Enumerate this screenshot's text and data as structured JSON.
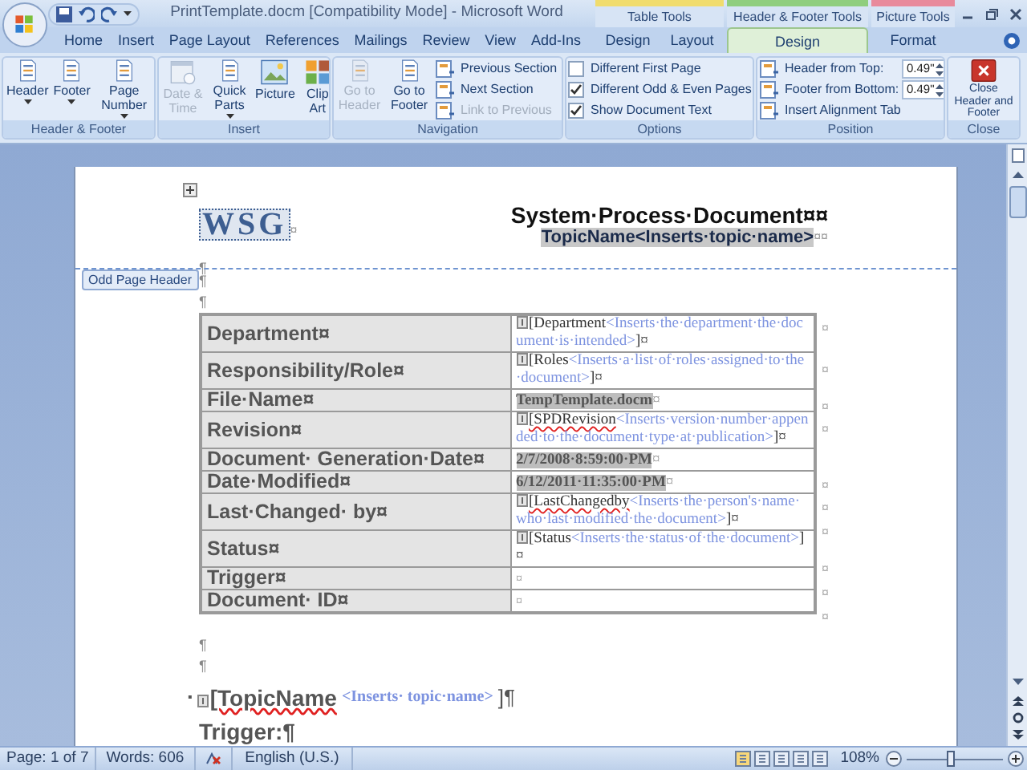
{
  "window": {
    "title": "PrintTemplate.docm [Compatibility Mode] - Microsoft Word"
  },
  "tabs": [
    {
      "label": "Home",
      "selected": false
    },
    {
      "label": "Insert",
      "selected": false
    },
    {
      "label": "Page Layout",
      "selected": false
    },
    {
      "label": "References",
      "selected": false
    },
    {
      "label": "Mailings",
      "selected": false
    },
    {
      "label": "Review",
      "selected": false
    },
    {
      "label": "View",
      "selected": false
    },
    {
      "label": "Add-Ins",
      "selected": false
    }
  ],
  "contextual": [
    {
      "title": "Table Tools",
      "color": "#f0dc6e",
      "tabs": [
        {
          "label": "Design",
          "selected": false
        },
        {
          "label": "Layout",
          "selected": false
        }
      ]
    },
    {
      "title": "Header & Footer Tools",
      "color": "#8fce7e",
      "tabs": [
        {
          "label": "Design",
          "selected": true
        }
      ]
    },
    {
      "title": "Picture Tools",
      "color": "#e88a9c",
      "tabs": [
        {
          "label": "Format",
          "selected": false
        }
      ]
    }
  ],
  "ribbon": [
    {
      "label": "Header & Footer",
      "items": [
        {
          "kind": "large",
          "label": "Header",
          "dropdown": true,
          "disabled": false
        },
        {
          "kind": "large",
          "label": "Footer",
          "dropdown": true,
          "disabled": false
        },
        {
          "kind": "large",
          "label": "Page Number",
          "dropdown": true,
          "disabled": false
        }
      ]
    },
    {
      "label": "Insert",
      "items": [
        {
          "kind": "large",
          "label": "Date & Time",
          "dropdown": false,
          "disabled": true
        },
        {
          "kind": "large",
          "label": "Quick Parts",
          "dropdown": true,
          "disabled": false
        },
        {
          "kind": "large",
          "label": "Picture",
          "dropdown": false,
          "disabled": false
        },
        {
          "kind": "large",
          "label": "Clip Art",
          "dropdown": false,
          "disabled": false
        }
      ]
    },
    {
      "label": "Navigation",
      "items": [
        {
          "kind": "large",
          "label": "Go to Header",
          "dropdown": false,
          "disabled": true
        },
        {
          "kind": "large",
          "label": "Go to Footer",
          "dropdown": false,
          "disabled": false
        },
        {
          "kind": "small",
          "label": "Previous Section",
          "disabled": false
        },
        {
          "kind": "small",
          "label": "Next Section",
          "disabled": false
        },
        {
          "kind": "small",
          "label": "Link to Previous",
          "disabled": true
        }
      ]
    },
    {
      "label": "Options",
      "items": [
        {
          "kind": "checkbox",
          "label": "Different First Page",
          "checked": false
        },
        {
          "kind": "checkbox",
          "label": "Different Odd & Even Pages",
          "checked": true
        },
        {
          "kind": "checkbox",
          "label": "Show Document Text",
          "checked": true
        }
      ]
    },
    {
      "label": "Position",
      "items": [
        {
          "kind": "spin",
          "label": "Header from Top:",
          "value": "0.49\""
        },
        {
          "kind": "spin",
          "label": "Footer from Bottom:",
          "value": "0.49\""
        },
        {
          "kind": "small",
          "label": "Insert Alignment Tab",
          "disabled": false
        }
      ]
    },
    {
      "label": "Close",
      "items": [
        {
          "kind": "close",
          "label": "Close Header and Footer"
        }
      ]
    }
  ],
  "header": {
    "logo": "WSG",
    "logo_mark": "¤",
    "title": "System·Process·Document¤¤",
    "topic": "TopicName<Inserts·topic·name>",
    "topic_mark": "¤¤",
    "mark": "¶",
    "tag": "Odd Page Header"
  },
  "marks_before_table": [
    "¶",
    "¶"
  ],
  "table": {
    "rows": [
      {
        "label": "Department¤",
        "value": {
          "kind": "field",
          "name": "[Department",
          "prompt": "<Inserts·the·department·the·document·is·intended>",
          "end": "]¤",
          "misspelled": false
        },
        "end_mark": "¤"
      },
      {
        "label": "Responsibility/Role¤",
        "value": {
          "kind": "field",
          "name": "[Roles",
          "prompt": "<Inserts·a·list·of·roles·assigned·to·the·document>",
          "end": "]¤",
          "misspelled": false
        },
        "end_mark": "¤"
      },
      {
        "label": "File·Name¤",
        "value": {
          "kind": "shaded",
          "text": "TempTemplate.docm",
          "end": "¤"
        },
        "end_mark": "¤"
      },
      {
        "label": "Revision¤",
        "value": {
          "kind": "field",
          "name": "[SPDRevision",
          "prompt": "<Inserts·version·number·appended·to·the·document·type·at·publication>",
          "end": "]¤",
          "misspelled": true
        },
        "end_mark": "¤"
      },
      {
        "label": "Document· Generation·Date¤",
        "value": {
          "kind": "shaded",
          "text": "2/7/2008·8:59:00·PM",
          "end": "¤"
        },
        "end_mark": "¤"
      },
      {
        "label": "Date·Modified¤",
        "value": {
          "kind": "shaded",
          "text": "6/12/2011·11:35:00·PM",
          "end": "¤"
        },
        "end_mark": "¤"
      },
      {
        "label": "Last·Changed· by¤",
        "value": {
          "kind": "field",
          "name": "[LastChangedby",
          "prompt": "<Inserts·the·person's·name·who·last·modified·the·document>",
          "end": "]¤",
          "misspelled": true
        },
        "end_mark": "¤"
      },
      {
        "label": "Status¤",
        "value": {
          "kind": "field",
          "name": "[Status",
          "prompt": "<Inserts·the·status·of·the·document>",
          "end": "]¤",
          "misspelled": false
        },
        "end_mark": "¤"
      },
      {
        "label": "Trigger¤",
        "value": {
          "kind": "empty",
          "end": "¤"
        },
        "end_mark": "¤"
      },
      {
        "label": "Document· ID¤",
        "value": {
          "kind": "empty",
          "end": "¤"
        },
        "end_mark": "¤"
      }
    ]
  },
  "marks_after_table": [
    "¶",
    "¶"
  ],
  "topic_item": {
    "bullet": "▪",
    "name": "[TopicName",
    "prompt": "<Inserts· topic·name>",
    "end": "]¶",
    "misspelled": true
  },
  "trigger_heading": "Trigger:¶",
  "status_bar": {
    "page": "Page: 1 of 7",
    "words": "Words: 606",
    "language": "English (U.S.)",
    "zoom": "108%",
    "zoom_slider": {
      "level": 0.45
    }
  }
}
